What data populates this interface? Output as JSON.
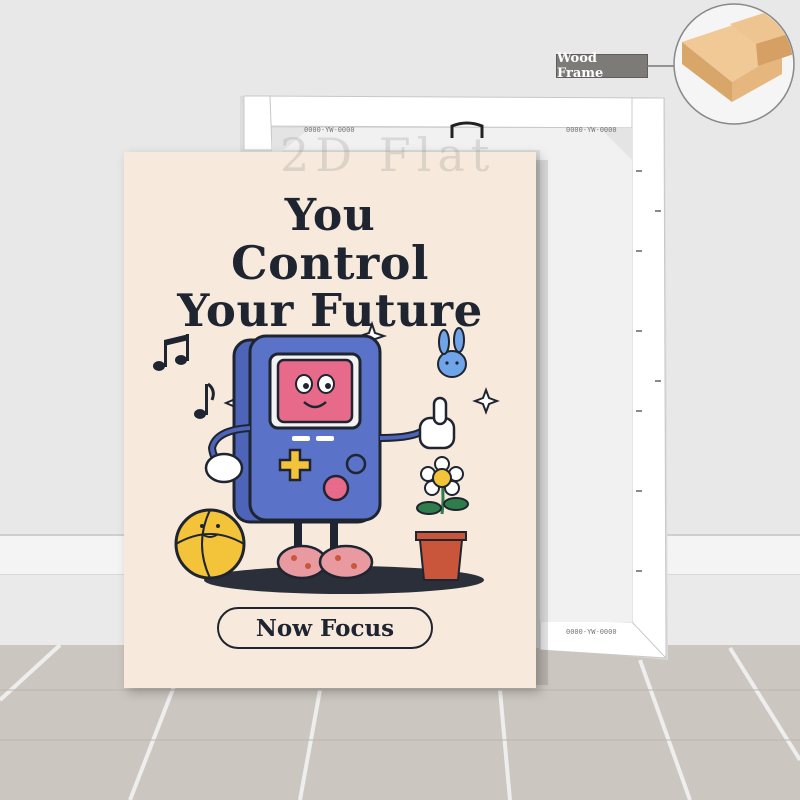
{
  "poster": {
    "line1": "You",
    "line2": "Control",
    "line3": "Your Future",
    "button": "Now Focus"
  },
  "wood_frame_label": "Wood Frame",
  "watermark": "2D Flat",
  "canvas_stamp": "0000-YW-0000",
  "colors": {
    "poster_bg": "#f7eadc",
    "text_dark": "#1f2530",
    "console_blue": "#4d64b8",
    "screen_pink": "#e86a8a",
    "ball_yellow": "#f3c33a",
    "pot_orange": "#c9563a",
    "wall": "#e9e9e9",
    "floor": "#cfcac4"
  }
}
